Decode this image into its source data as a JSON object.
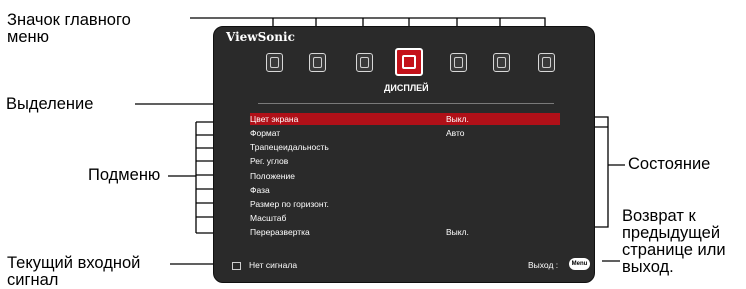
{
  "annotations": {
    "main_menu_icon": "Значок главного\nменю",
    "highlight": "Выделение",
    "submenu": "Подменю",
    "current_input": "Текущий входной\nсигнал",
    "status": "Состояние",
    "back": "Возврат к\nпредыдущей\nстранице или\nвыход."
  },
  "osd": {
    "brand": "ViewSonic",
    "tab_title": "ДИСПЛЕЙ",
    "icons": [
      "picture-icon",
      "color-icon",
      "image-icon",
      "display-icon",
      "settings-icon",
      "advanced-icon",
      "info-icon"
    ],
    "selected_icon_index": 3,
    "rows": [
      {
        "label": "Цвет экрана",
        "value": "Выкл."
      },
      {
        "label": "Формат",
        "value": "Авто"
      },
      {
        "label": "Трапецеидальность",
        "value": ""
      },
      {
        "label": "Рег. углов",
        "value": ""
      },
      {
        "label": "Положение",
        "value": ""
      },
      {
        "label": "Фаза",
        "value": ""
      },
      {
        "label": "Размер по горизонт.",
        "value": ""
      },
      {
        "label": "Масштаб",
        "value": ""
      },
      {
        "label": "Переразвертка",
        "value": "Выкл."
      }
    ],
    "selected_row_index": 0,
    "footer_signal": "Нет сигнала",
    "footer_exit": "Выход :",
    "menu_button": "Menu"
  },
  "colors": {
    "panel": "#2a2a2a",
    "highlight": "#b01018",
    "selected_icon": "#c4121a"
  }
}
